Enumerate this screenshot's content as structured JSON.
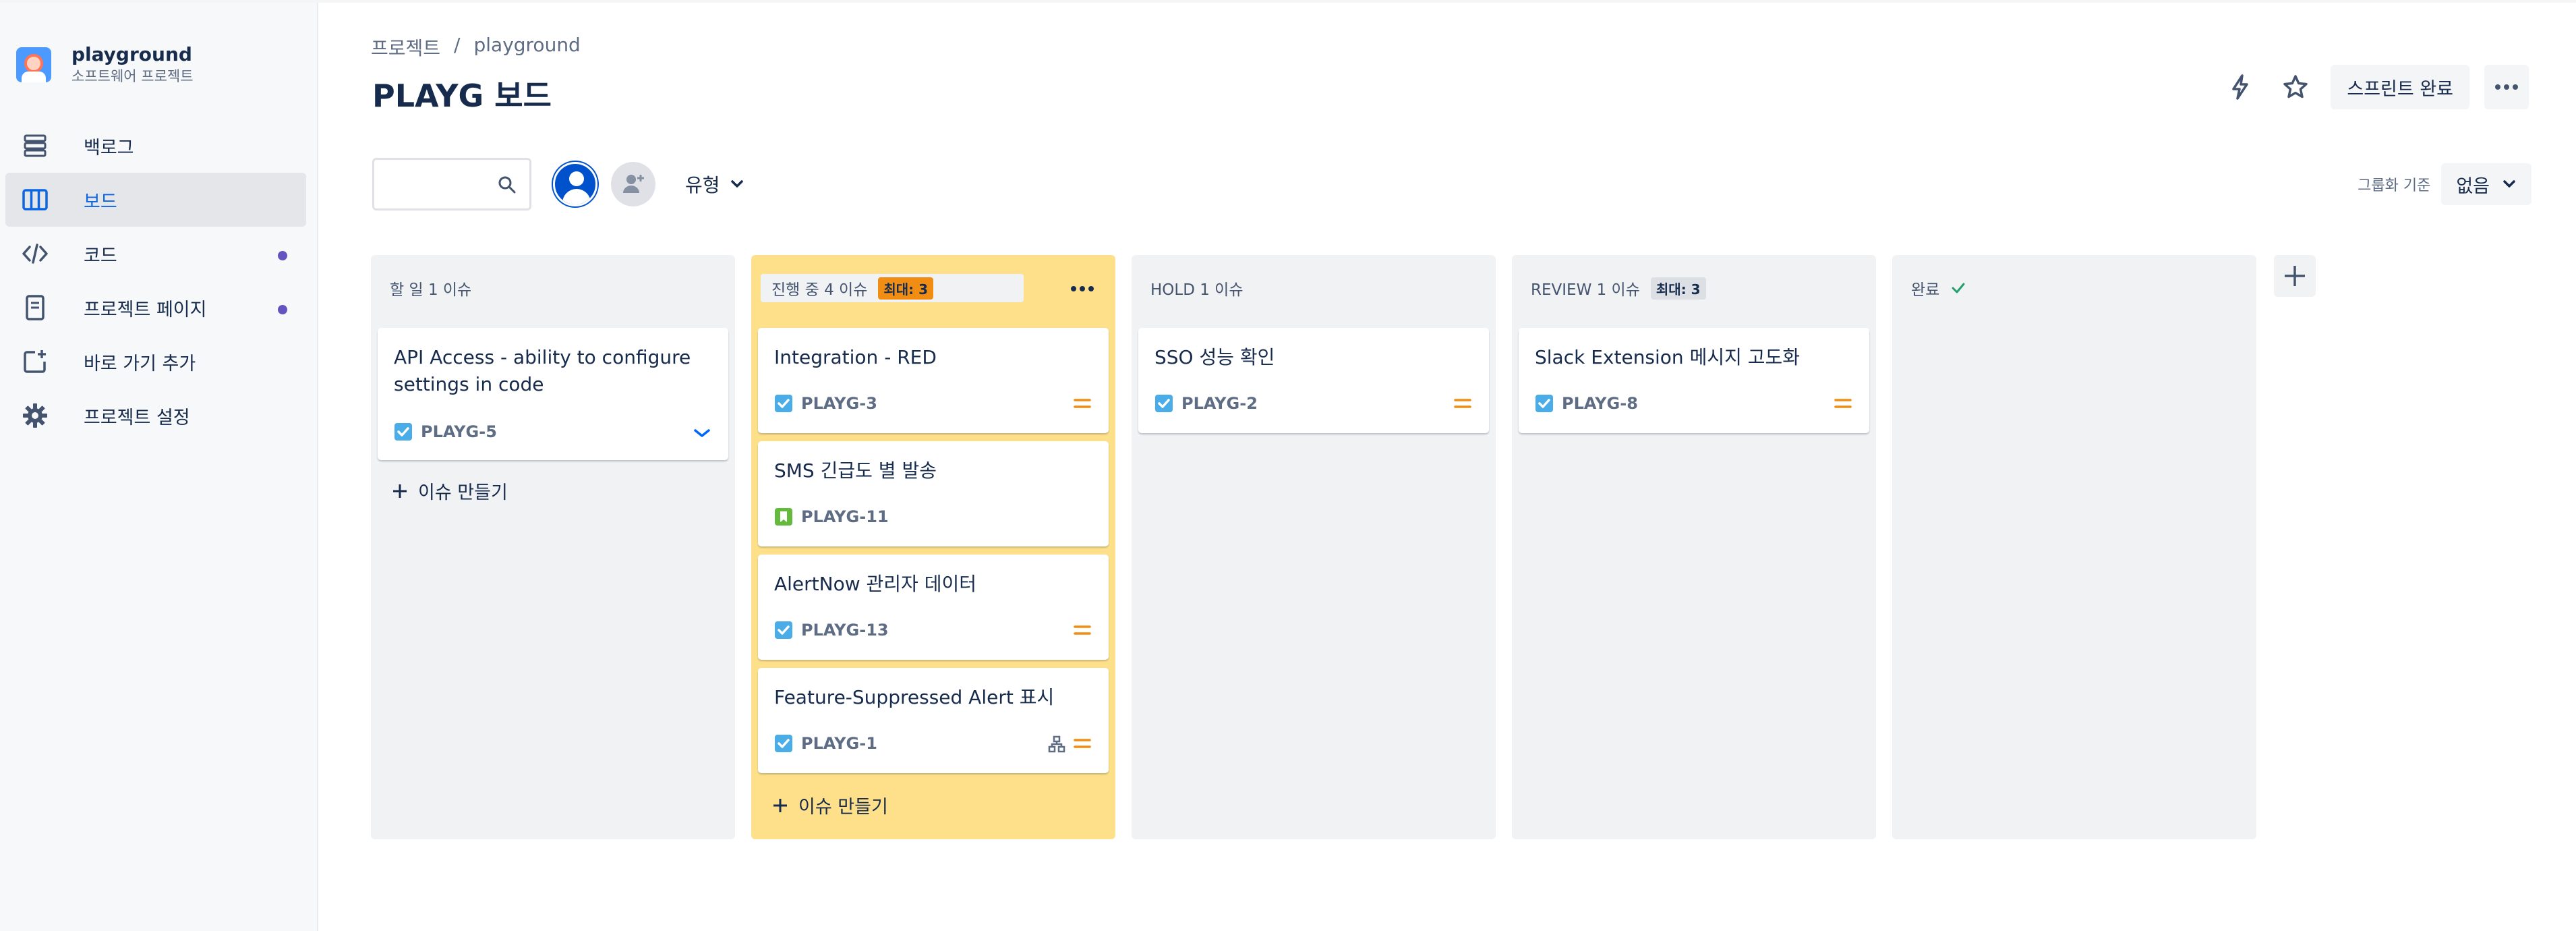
{
  "sidebar": {
    "project_name": "playground",
    "project_type": "소프트웨어 프로젝트",
    "items": [
      {
        "label": "백로그",
        "icon": "backlog-icon",
        "active": false,
        "dot": false
      },
      {
        "label": "보드",
        "icon": "board-icon",
        "active": true,
        "dot": false
      },
      {
        "label": "코드",
        "icon": "code-icon",
        "active": false,
        "dot": true
      },
      {
        "label": "프로젝트 페이지",
        "icon": "page-icon",
        "active": false,
        "dot": true
      },
      {
        "label": "바로 가기 추가",
        "icon": "add-shortcut-icon",
        "active": false,
        "dot": false
      },
      {
        "label": "프로젝트 설정",
        "icon": "gear-icon",
        "active": false,
        "dot": false
      }
    ]
  },
  "header": {
    "breadcrumb": [
      "프로젝트",
      "/",
      "playground"
    ],
    "title": "PLAYG 보드",
    "complete_sprint": "스프린트 완료"
  },
  "toolbar": {
    "search_value": "",
    "type_filter": "유형",
    "group_by_label": "그룹화 기준",
    "group_by_value": "없음"
  },
  "columns": [
    {
      "title": "할 일 1 이슈",
      "cards": [
        {
          "title": "API Access - ability to configure settings in code",
          "key": "PLAYG-5",
          "type": "task",
          "priority": "low"
        }
      ],
      "create": "이슈 만들기"
    },
    {
      "title": "진행 중 4 이슈",
      "badge": "최대: 3",
      "cards": [
        {
          "title": "Integration - RED",
          "key": "PLAYG-3",
          "type": "task",
          "priority": "medium"
        },
        {
          "title": "SMS 긴급도 별 발송",
          "key": "PLAYG-11",
          "type": "story",
          "priority": ""
        },
        {
          "title": "AlertNow 관리자 데이터",
          "key": "PLAYG-13",
          "type": "task",
          "priority": "medium"
        },
        {
          "title": "Feature-Suppressed Alert 표시",
          "key": "PLAYG-1",
          "type": "task",
          "priority": "medium",
          "child": true
        }
      ],
      "create": "이슈 만들기"
    },
    {
      "title": "HOLD 1 이슈",
      "cards": [
        {
          "title": "SSO 성능 확인",
          "key": "PLAYG-2",
          "type": "task",
          "priority": "medium"
        }
      ]
    },
    {
      "title": "REVIEW 1 이슈",
      "badge": "최대: 3",
      "cards": [
        {
          "title": "Slack Extension 메시지 고도화",
          "key": "PLAYG-8",
          "type": "task",
          "priority": "medium"
        }
      ]
    },
    {
      "title": "완료",
      "cards": []
    }
  ],
  "colors": {
    "accent": "#0052cc",
    "active_column": "#ffe08a",
    "over_limit_badge": "#f18d13",
    "priority_medium": "#f18d13",
    "priority_low": "#0065ff",
    "task": "#4bade8",
    "story": "#63ba3c"
  }
}
